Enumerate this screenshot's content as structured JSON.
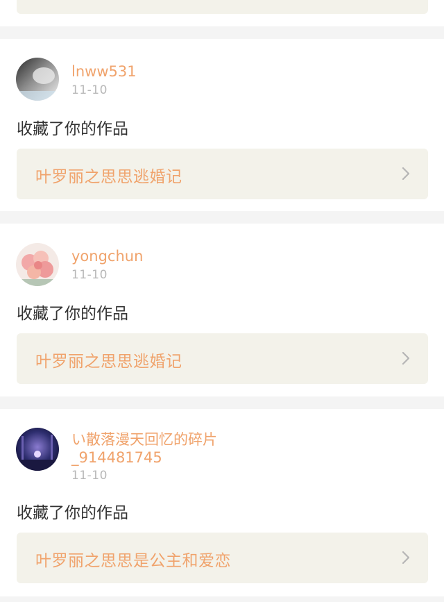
{
  "notifications": [
    {
      "username": "lnww531",
      "date": "11-10",
      "action": "收藏了你的作品",
      "work_title": "叶罗丽之思思逃婚记",
      "avatar_icon": "avatar-icon"
    },
    {
      "username": "yongchun",
      "date": "11-10",
      "action": "收藏了你的作品",
      "work_title": "叶罗丽之思思逃婚记",
      "avatar_icon": "avatar-icon"
    },
    {
      "username": "い散落漫天回忆的碎片_914481745",
      "username_line1": "い散落漫天回忆的碎片",
      "username_line2": "_914481745",
      "date": "11-10",
      "action": "收藏了你的作品",
      "work_title": "叶罗丽之思思是公主和爱恋",
      "avatar_icon": "avatar-icon"
    }
  ],
  "colors": {
    "accent": "#f0a36c",
    "work_box_bg": "#f3f2ea",
    "separator": "#f4f4f4",
    "date_text": "#b8b8b8",
    "action_text": "#333333",
    "chevron": "#b5b5b5"
  },
  "icons": {
    "chevron": "chevron-right-icon"
  }
}
